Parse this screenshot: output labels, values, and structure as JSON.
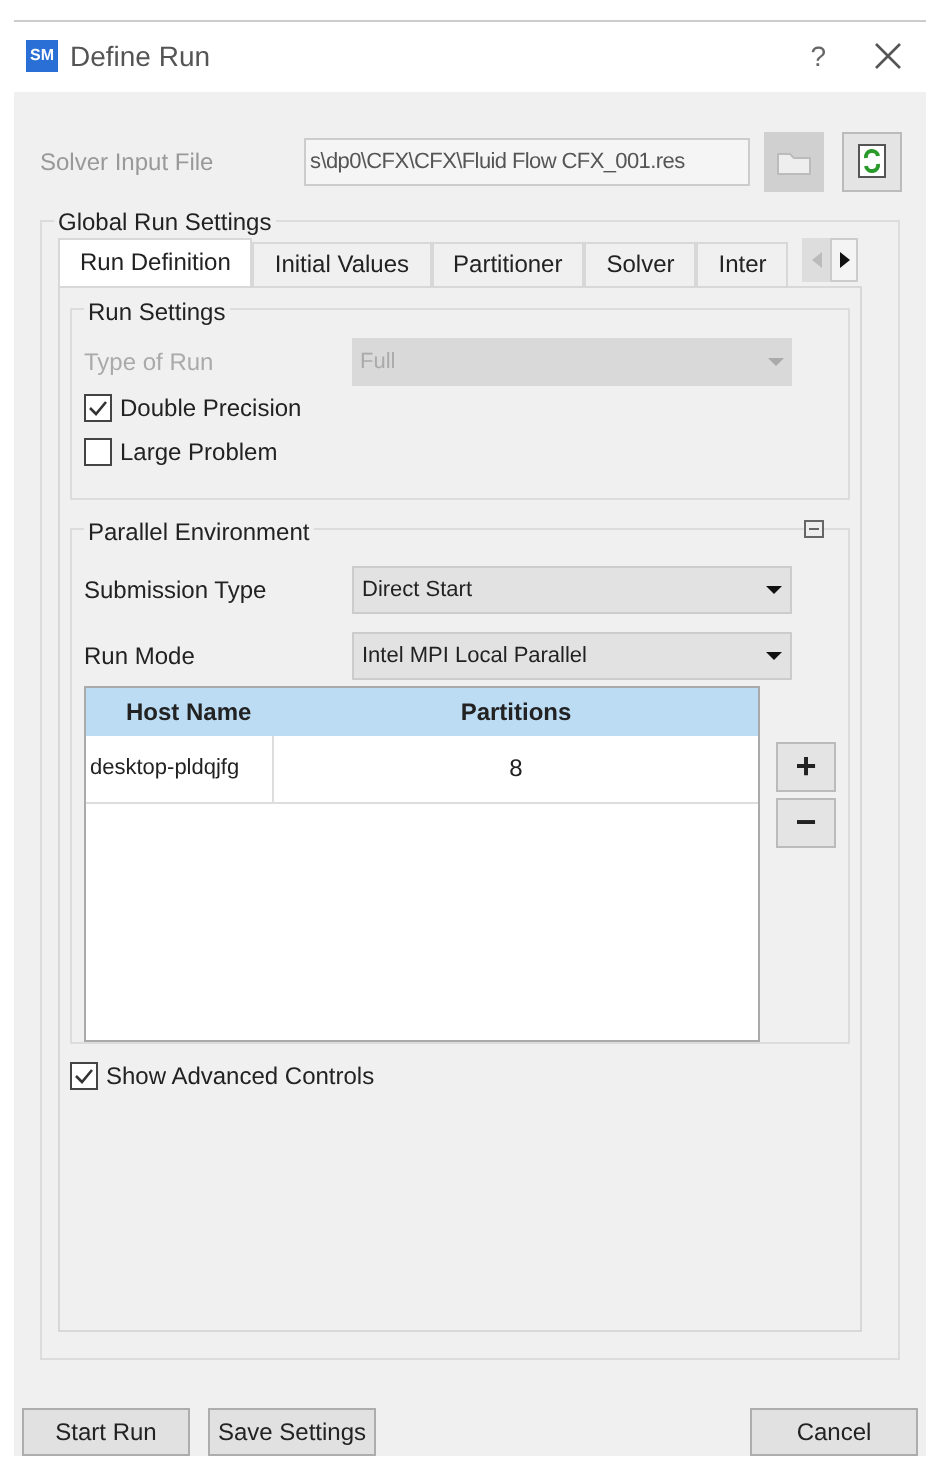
{
  "window": {
    "app_badge": "SM",
    "title": "Define Run",
    "help": "?"
  },
  "solver_input_file": {
    "label": "Solver Input File",
    "value": "s\\dp0\\CFX\\CFX\\Fluid Flow CFX_001.res",
    "disabled": true
  },
  "global_run_settings": {
    "title": "Global Run Settings",
    "tabs": [
      {
        "label": "Run Definition",
        "selected": true
      },
      {
        "label": "Initial Values",
        "selected": false
      },
      {
        "label": "Partitioner",
        "selected": false
      },
      {
        "label": "Solver",
        "selected": false
      },
      {
        "label": "Inter",
        "selected": false
      }
    ]
  },
  "run_settings": {
    "title": "Run Settings",
    "type_of_run": {
      "label": "Type of Run",
      "value": "Full",
      "disabled": true
    },
    "checkboxes": [
      {
        "label": "Double Precision",
        "checked": true
      },
      {
        "label": "Large Problem",
        "checked": false
      }
    ]
  },
  "parallel_environment": {
    "title": "Parallel Environment",
    "submission_type": {
      "label": "Submission Type",
      "value": "Direct Start"
    },
    "run_mode": {
      "label": "Run Mode",
      "value": "Intel MPI Local Parallel"
    },
    "table": {
      "columns": [
        "Host Name",
        "Partitions"
      ],
      "rows": [
        [
          "desktop-pldqjfg",
          "8"
        ]
      ]
    },
    "add": "+",
    "remove": "−"
  },
  "show_advanced_controls": {
    "label": "Show Advanced Controls",
    "checked": true
  },
  "buttons": [
    {
      "label": "Start Run",
      "kind": "left"
    },
    {
      "label": "Save Settings",
      "kind": "left"
    },
    {
      "label": "Cancel",
      "kind": "right"
    }
  ]
}
